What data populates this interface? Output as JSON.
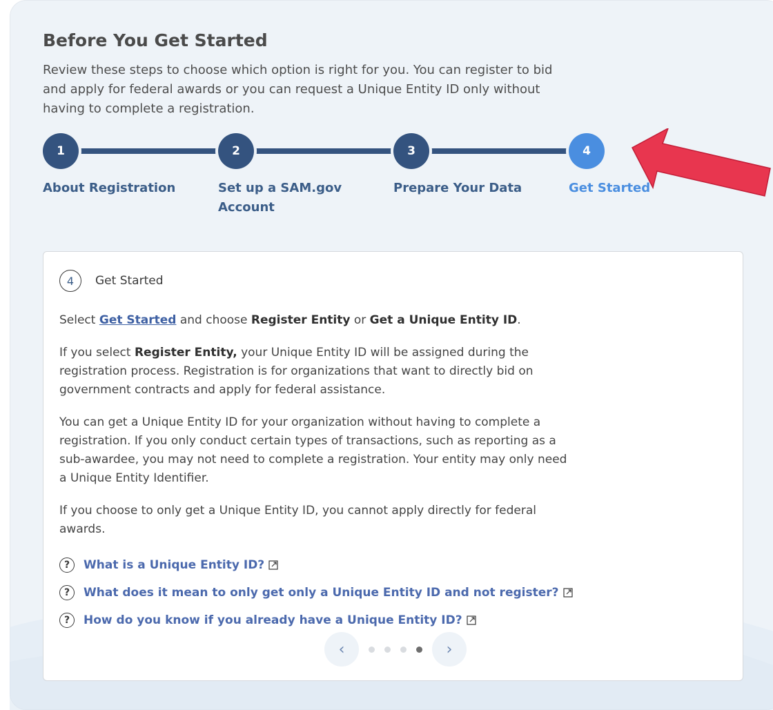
{
  "header": {
    "title": "Before You Get Started",
    "intro": "Review these steps to choose which option is right for you. You can register to bid and apply for federal awards or you can request a Unique Entity ID only without having to complete a registration."
  },
  "stepper": {
    "steps": [
      {
        "number": "1",
        "label": "About Registration"
      },
      {
        "number": "2",
        "label": "Set up a SAM.gov Account"
      },
      {
        "number": "3",
        "label": "Prepare Your Data"
      },
      {
        "number": "4",
        "label": "Get Started"
      }
    ],
    "active_step": 4
  },
  "card": {
    "step_number": "4",
    "step_title": "Get Started",
    "p1_prefix": "Select ",
    "p1_link": "Get Started",
    "p1_mid": " and choose ",
    "p1_opt1": "Register Entity",
    "p1_or": " or ",
    "p1_opt2": "Get a Unique Entity ID",
    "p1_end": ".",
    "p2_prefix": "If you select ",
    "p2_bold": "Register Entity,",
    "p2_rest": " your Unique Entity ID will be assigned during the registration process. Registration is for organizations that want to directly bid on government contracts and apply for federal assistance.",
    "p3": "You can get a Unique Entity ID for your organization without having to complete a registration. If you only conduct certain types of transactions, such as reporting as a sub-awardee, you may not need to complete a registration. Your entity may only need a Unique Entity Identifier.",
    "p4": "If you choose to only get a Unique Entity ID, you cannot apply directly for federal awards."
  },
  "faq": {
    "icon_glyph": "?",
    "items": [
      {
        "label": "What is a Unique Entity ID?"
      },
      {
        "label": "What does it mean to only get only a Unique Entity ID and not register?"
      },
      {
        "label": "How do you know if you already have a Unique Entity ID?"
      }
    ]
  },
  "carousel": {
    "prev_glyph": "‹",
    "next_glyph": "›",
    "total": 4,
    "current": 4
  },
  "colors": {
    "step_complete": "#34537f",
    "step_active": "#4a8ee0",
    "link": "#4b69ad",
    "annotation_arrow": "#e8364f"
  }
}
